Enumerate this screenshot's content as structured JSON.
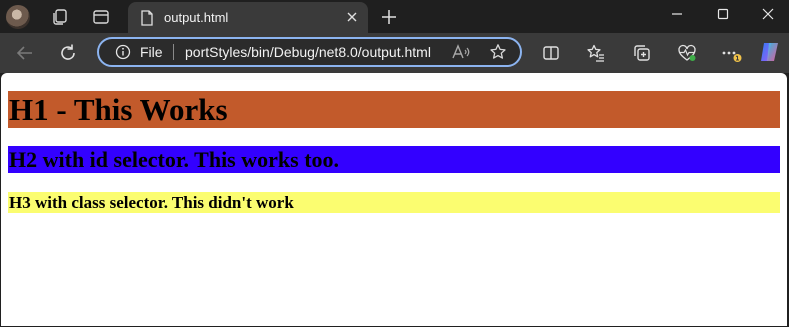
{
  "tab": {
    "title": "output.html"
  },
  "address_bar": {
    "scheme_label": "File",
    "url": "portStyles/bin/Debug/net8.0/output.html"
  },
  "colors": {
    "h1_background": "#c25a2b",
    "h2_background": "#3300ff",
    "h3_background": "#fbfd70"
  },
  "content": {
    "h1": "H1 - This Works",
    "h2": "H2 with id selector. This works too.",
    "h3": "H3 with class selector. This didn't work"
  },
  "icons": {
    "avatar": "profile-avatar",
    "workspaces": "workspaces-icon",
    "tab_actions": "tab-actions-icon",
    "tab_file": "document-icon",
    "tab_close": "close-icon",
    "new_tab": "plus-icon",
    "minimize": "minimize-icon",
    "maximize": "maximize-icon",
    "close_window": "close-icon",
    "back": "back-arrow-icon",
    "refresh": "refresh-icon",
    "info": "info-icon",
    "read_aloud": "read-aloud-icon",
    "favorite": "star-icon",
    "split_screen": "split-screen-icon",
    "favorites": "favorites-icon",
    "collections": "collections-icon",
    "browser_essentials": "heart-pulse-icon",
    "more": "more-dots-icon",
    "copilot": "copilot-icon"
  }
}
